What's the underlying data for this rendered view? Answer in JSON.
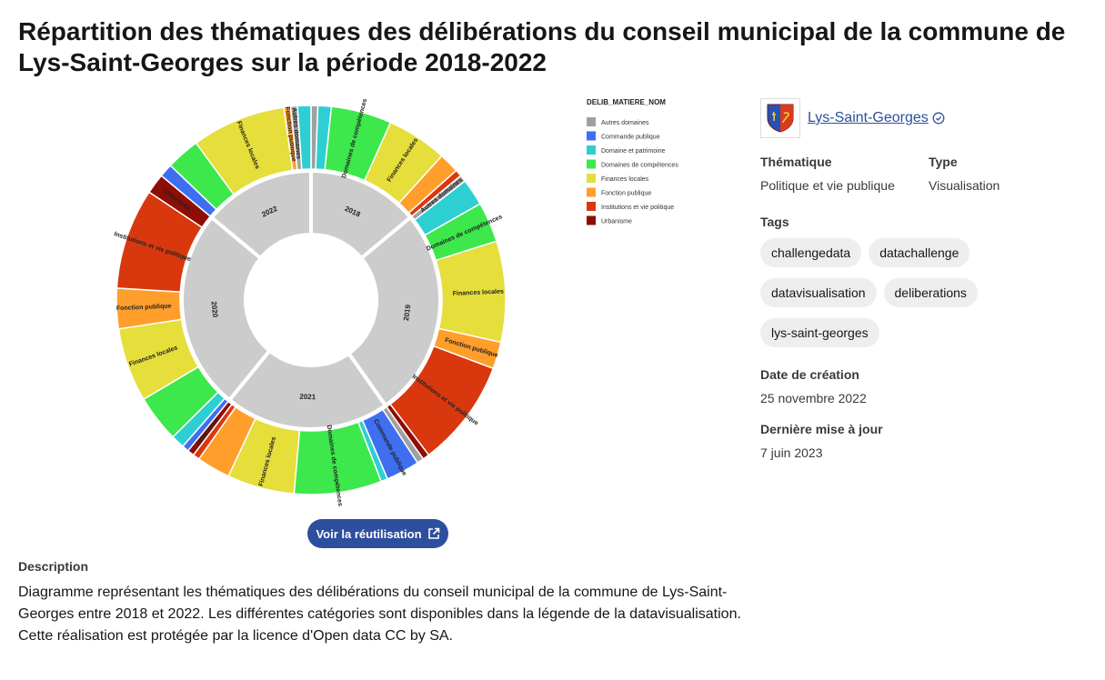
{
  "page": {
    "title": "Répartition des thématiques des délibérations du conseil municipal de la commune de Lys-Saint-Georges sur la période 2018-2022"
  },
  "reuse_button": {
    "label": "Voir la réutilisation"
  },
  "description": {
    "heading": "Description",
    "paragraphs": [
      "Diagramme représentant les thématiques des délibérations du conseil municipal de la commune de Lys-Saint-Georges entre 2018 et 2022. Les différentes catégories sont disponibles dans la légende de la datavisualisation.",
      "Cette réalisation est protégée par la licence d'Open data CC by SA."
    ]
  },
  "sidebar": {
    "org_name": "Lys-Saint-Georges",
    "org_verified_icon": "verified-badge-icon",
    "thematique_label": "Thématique",
    "thematique_value": "Politique et vie publique",
    "type_label": "Type",
    "type_value": "Visualisation",
    "tags_label": "Tags",
    "tags": [
      "challengedata",
      "datachallenge",
      "datavisualisation",
      "deliberations",
      "lys-saint-georges"
    ],
    "created_label": "Date de création",
    "created_value": "25 novembre 2022",
    "updated_label": "Dernière mise à jour",
    "updated_value": "7 juin 2023"
  },
  "colors": {
    "accent": "#2e4f9e",
    "year_ring": "#cccccc"
  },
  "chart_data": {
    "type": "sunburst",
    "legend_title": "DELIB_MATIERE_NOM",
    "legend_position": "right",
    "categories": [
      {
        "name": "Autres domaines",
        "color": "#a0a0a0"
      },
      {
        "name": "Commande publique",
        "color": "#3f6ff0"
      },
      {
        "name": "Domaine et patrimoine",
        "color": "#2dcfd2"
      },
      {
        "name": "Domaines de compétences",
        "color": "#3ce84b"
      },
      {
        "name": "Finances locales",
        "color": "#e5de3b"
      },
      {
        "name": "Fonction publique",
        "color": "#ff9e2a"
      },
      {
        "name": "Institutions et vie politique",
        "color": "#d9380f"
      },
      {
        "name": "Urbanisme",
        "color": "#8e0d04"
      }
    ],
    "years": [
      {
        "label": "2018",
        "segments": [
          {
            "category": "Autres domaines",
            "value": 1
          },
          {
            "category": "Domaine et patrimoine",
            "value": 2
          },
          {
            "category": "Domaines de compétences",
            "value": 9
          },
          {
            "category": "Finances locales",
            "value": 9
          },
          {
            "category": "Fonction publique",
            "value": 3
          },
          {
            "category": "Institutions et vie politique",
            "value": 1
          }
        ]
      },
      {
        "label": "2019",
        "segments": [
          {
            "category": "Autres domaines",
            "value": 1
          },
          {
            "category": "Domaine et patrimoine",
            "value": 4
          },
          {
            "category": "Domaines de compétences",
            "value": 6
          },
          {
            "category": "Finances locales",
            "value": 15
          },
          {
            "category": "Fonction publique",
            "value": 4
          },
          {
            "category": "Institutions et vie politique",
            "value": 16
          },
          {
            "category": "Urbanisme",
            "value": 1
          }
        ]
      },
      {
        "label": "2021",
        "segments": [
          {
            "category": "Autres domaines",
            "value": 1
          },
          {
            "category": "Commande publique",
            "value": 5
          },
          {
            "category": "Domaine et patrimoine",
            "value": 1
          },
          {
            "category": "Domaines de compétences",
            "value": 13
          },
          {
            "category": "Finances locales",
            "value": 10
          },
          {
            "category": "Fonction publique",
            "value": 5
          },
          {
            "category": "Institutions et vie politique",
            "value": 1
          },
          {
            "category": "Urbanisme",
            "value": 1
          }
        ]
      },
      {
        "label": "2020",
        "segments": [
          {
            "category": "Commande publique",
            "value": 1
          },
          {
            "category": "Domaine et patrimoine",
            "value": 2
          },
          {
            "category": "Domaines de compétences",
            "value": 7
          },
          {
            "category": "Finances locales",
            "value": 11
          },
          {
            "category": "Fonction publique",
            "value": 6
          },
          {
            "category": "Institutions et vie politique",
            "value": 15
          },
          {
            "category": "Urbanisme",
            "value": 3
          }
        ]
      },
      {
        "label": "2022",
        "segments": [
          {
            "category": "Commande publique",
            "value": 2
          },
          {
            "category": "Domaines de compétences",
            "value": 5
          },
          {
            "category": "Finances locales",
            "value": 14
          },
          {
            "category": "Fonction publique",
            "value": 1
          },
          {
            "category": "Autres domaines",
            "value": 1
          },
          {
            "category": "Domaine et patrimoine",
            "value": 2
          }
        ]
      }
    ],
    "segment_labels": [
      {
        "year": "2018",
        "category": "Domaines de compétences",
        "text": "Domaines de compétences"
      },
      {
        "year": "2018",
        "category": "Finances locales",
        "text": "Finances locales"
      },
      {
        "year": "2019",
        "category": "Autres domaines",
        "text": "Autres domaines"
      },
      {
        "year": "2019",
        "category": "Domaines de compétences",
        "text": "Domaines de compétences"
      },
      {
        "year": "2019",
        "category": "Finances locales",
        "text": "Finances locales"
      },
      {
        "year": "2019",
        "category": "Fonction publique",
        "text": "Fonction publique"
      },
      {
        "year": "2019",
        "category": "Institutions et vie politique",
        "text": "Institutions et vie politique"
      },
      {
        "year": "2021",
        "category": "Commande publique",
        "text": "Commande publique"
      },
      {
        "year": "2021",
        "category": "Domaines de compétences",
        "text": "Domaines de compétences"
      },
      {
        "year": "2021",
        "category": "Finances locales",
        "text": "Finances locales"
      },
      {
        "year": "2021",
        "category": "Urbanisme",
        "text": "Urbanisme"
      },
      {
        "year": "2020",
        "category": "Finances locales",
        "text": "Finances locales"
      },
      {
        "year": "2020",
        "category": "Fonction publique",
        "text": "Fonction publique"
      },
      {
        "year": "2020",
        "category": "Institutions et vie politique",
        "text": "Institutions et vie politique"
      },
      {
        "year": "2020",
        "category": "Urbanisme",
        "text": "Urbanisme"
      },
      {
        "year": "2022",
        "category": "Finances locales",
        "text": "Finances locales"
      },
      {
        "year": "2022",
        "category": "Fonction publique",
        "text": "Fonction publique"
      },
      {
        "year": "2022",
        "category": "Autres domaines",
        "text": "Autres domaines"
      }
    ]
  }
}
